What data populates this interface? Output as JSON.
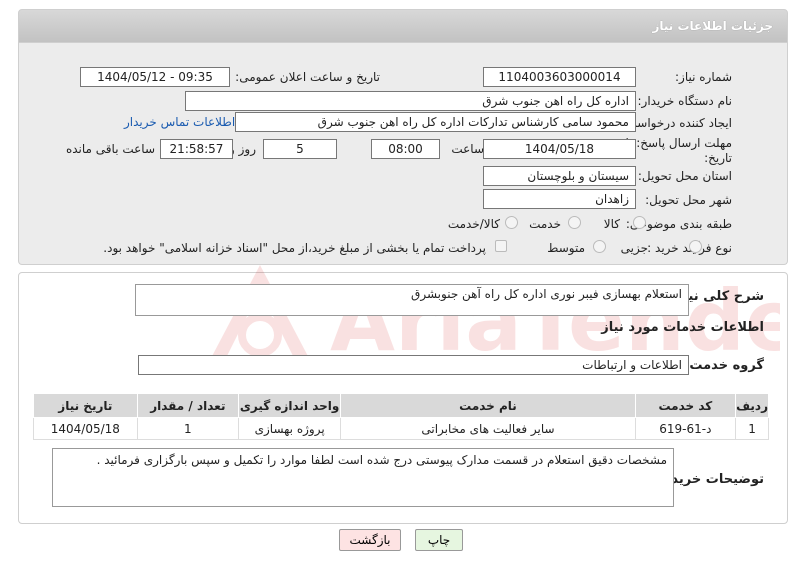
{
  "header": {
    "title": "جزئیات اطلاعات نیاز"
  },
  "fields": {
    "need_number_label": "شماره نیاز:",
    "need_number": "1104003603000014",
    "announce_label": "تاریخ و ساعت اعلان عمومی:",
    "announce_value": "1404/05/12 - 09:35",
    "buyer_org_label": "نام دستگاه خریدار:",
    "buyer_org": "اداره کل راه اهن جنوب شرق",
    "creator_label": "ایجاد کننده درخواست:",
    "creator": "محمود سامی  کارشناس تدارکات  اداره کل راه اهن جنوب شرق",
    "contact_link": "اطلاعات تماس خریدار",
    "deadline_label": "مهلت ارسال پاسخ: تا تاریخ:",
    "deadline_date": "1404/05/18",
    "time_label": "ساعت",
    "deadline_time": "08:00",
    "days_value": "5",
    "days_label": "روز و",
    "remaining_time": "21:58:57",
    "remaining_label": "ساعت باقی مانده",
    "province_label": "استان محل تحویل:",
    "province": "سیستان و بلوچستان",
    "city_label": "شهر محل تحویل:",
    "city": "زاهدان",
    "category_label": "طبقه بندی موضوعی:",
    "category_options": [
      "کالا",
      "خدمت",
      "کالا/خدمت"
    ],
    "process_label": "نوع فرآیند خرید :",
    "process_options": [
      "جزیی",
      "متوسط"
    ],
    "payment_note": "پرداخت تمام یا بخشی از مبلغ خرید،از محل \"اسناد خزانه اسلامی\" خواهد بود."
  },
  "summary": {
    "label": "شرح کلی نیاز:",
    "value": "استعلام بهسازی فیبر نوری اداره کل راه آهن جنوبشرق"
  },
  "services": {
    "section_title": "اطلاعات خدمات مورد نیاز",
    "group_label": "گروه خدمت:",
    "group_value": "اطلاعات و ارتباطات",
    "columns": [
      "ردیف",
      "کد خدمت",
      "نام خدمت",
      "واحد اندازه گیری",
      "تعداد / مقدار",
      "تاریخ نیاز"
    ],
    "rows": [
      [
        "1",
        "د-61-619",
        "سایر فعالیت های مخابراتی",
        "پروژه بهسازی",
        "1",
        "1404/05/18"
      ]
    ]
  },
  "buyer_notes": {
    "label": "توضیحات خریدار:",
    "value": "مشخصات دقیق استعلام در قسمت مدارک پیوستی درج شده است لطفا موارد را تکمیل و سپس بارگزاری فرمائید ."
  },
  "buttons": {
    "print": "چاپ",
    "back": "بازگشت"
  },
  "watermark": {
    "text": "AriaTender.neT"
  },
  "colors": {
    "header_bg": "#c8c8c8",
    "panel_bg": "#ececec",
    "link": "#1a5bb0",
    "back_button_bg": "#fde3e3",
    "print_button_bg": "#e6f6e0",
    "watermark": "#d62020"
  }
}
